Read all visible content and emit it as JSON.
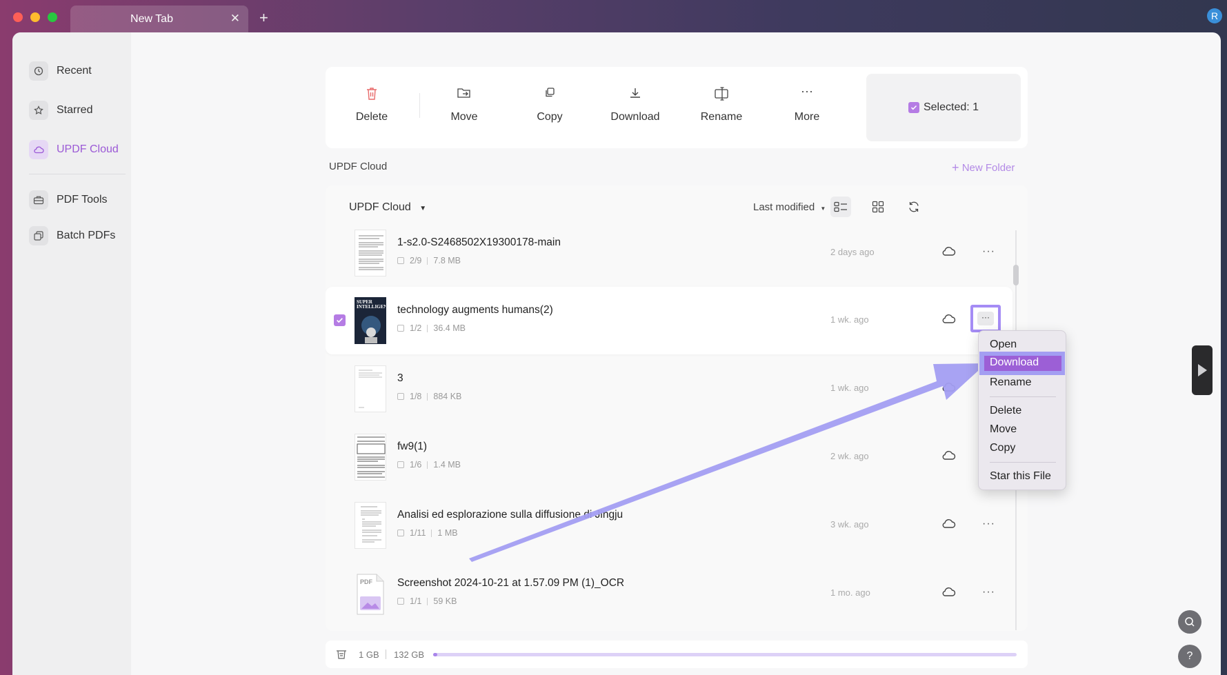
{
  "browser": {
    "tab_title": "New Tab",
    "tab_close_icon": "close-icon",
    "new_tab_icon": "plus-icon",
    "profile_initial": "R"
  },
  "sidebar": {
    "items": [
      {
        "label": "Recent",
        "icon": "clock-icon"
      },
      {
        "label": "Starred",
        "icon": "star-icon"
      },
      {
        "label": "UPDF Cloud",
        "icon": "cloud-icon"
      },
      {
        "label": "PDF Tools",
        "icon": "toolbox-icon"
      },
      {
        "label": "Batch PDFs",
        "icon": "stack-icon"
      }
    ],
    "active": "UPDF Cloud"
  },
  "toolbar": {
    "delete": "Delete",
    "move": "Move",
    "copy": "Copy",
    "download": "Download",
    "rename": "Rename",
    "more": "More",
    "selected": "Selected: 1"
  },
  "section": {
    "title": "UPDF Cloud",
    "new_folder": "New Folder"
  },
  "list": {
    "location": "UPDF Cloud",
    "sort": "Last modified",
    "files": [
      {
        "name": "1-s2.0-S2468502X19300178-main",
        "pages": "2/9",
        "size": "7.8 MB",
        "time": "2 days ago",
        "selected": false
      },
      {
        "name": "technology augments humans(2)",
        "pages": "1/2",
        "size": "36.4 MB",
        "time": "1 wk. ago",
        "selected": true
      },
      {
        "name": "3",
        "pages": "1/8",
        "size": "884 KB",
        "time": "1 wk. ago",
        "selected": false
      },
      {
        "name": "fw9(1)",
        "pages": "1/6",
        "size": "1.4 MB",
        "time": "2 wk. ago",
        "selected": false
      },
      {
        "name": "Analisi ed esplorazione sulla diffusione di Jingju",
        "pages": "1/11",
        "size": "1 MB",
        "time": "3 wk. ago",
        "selected": false
      },
      {
        "name": "Screenshot 2024-10-21 at 1.57.09 PM (1)_OCR",
        "pages": "1/1",
        "size": "59 KB",
        "time": "1 mo. ago",
        "selected": false
      }
    ],
    "thumb_cover_text": "SUPER INTELLIGENCE",
    "thumb_pdf_label": "PDF"
  },
  "storage": {
    "used": "1 GB",
    "total": "132 GB",
    "fraction_used": 0.0076
  },
  "context_menu": {
    "items": [
      "Open",
      "Download",
      "Rename",
      "Delete",
      "Move",
      "Copy",
      "Star this File"
    ],
    "highlighted": "Download"
  },
  "colors": {
    "accent": "#9b59d6",
    "annotation_arrow": "#a39ef2"
  }
}
